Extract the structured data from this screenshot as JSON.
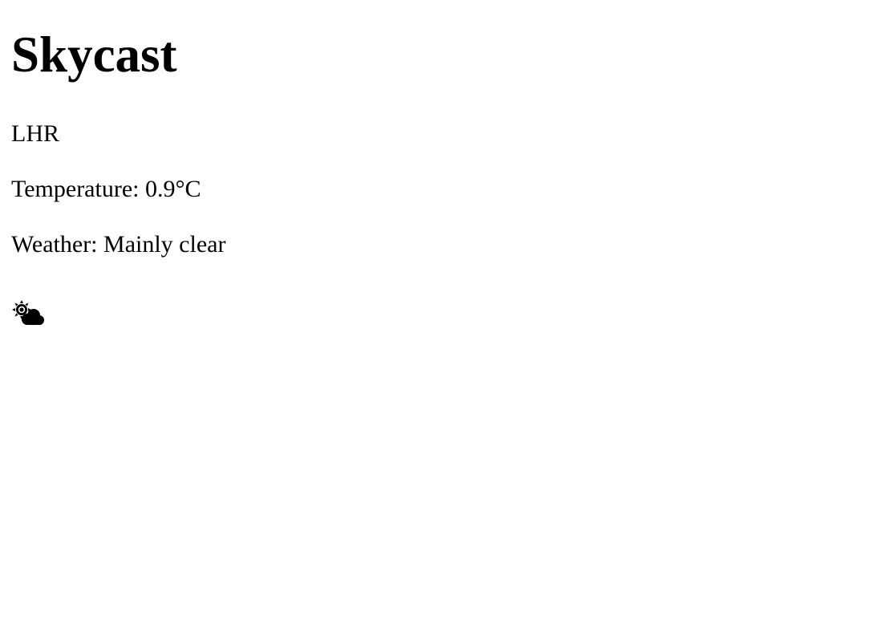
{
  "app": {
    "title": "Skycast"
  },
  "current": {
    "station": "LHR",
    "temperature_text": "Temperature: 0.9°C",
    "weather_text": "Weather: Mainly clear",
    "icon": "sun-behind-cloud-icon"
  },
  "colors": {
    "background": "#ffffff",
    "text": "#000000"
  }
}
